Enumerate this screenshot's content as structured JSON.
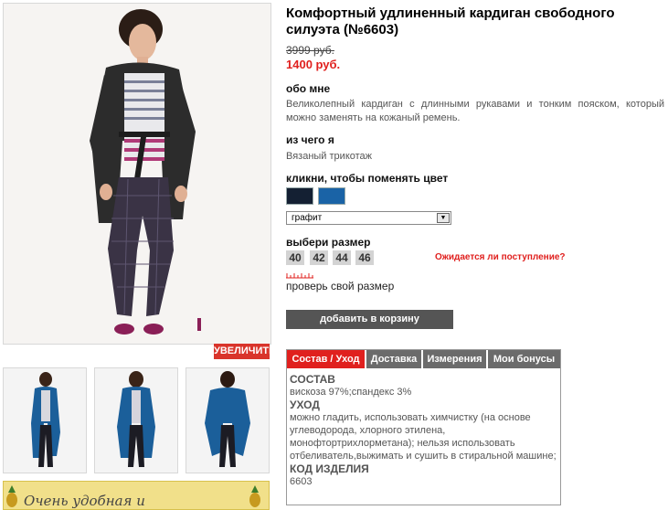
{
  "product": {
    "title": "Комфортный удлиненный кардиган свободного силуэта (№6603)",
    "old_price": "3999 руб.",
    "new_price": "1400 руб.",
    "zoom_label": "УВЕЛИЧИТЬ"
  },
  "about": {
    "heading": "обо мне",
    "text": "Великолепный кардиган с длинными рукавами и тонким пояском, который можно заменять на кожаный ремень."
  },
  "material": {
    "heading": "из чего я",
    "text": "Вязаный трикотаж"
  },
  "color": {
    "heading": "кликни, чтобы поменять цвет",
    "swatches": [
      "#142033",
      "#1a63a6"
    ],
    "selected": "графит"
  },
  "size": {
    "heading": "выбери размер",
    "options": [
      "40",
      "42",
      "44",
      "46"
    ],
    "availability_link": "Ожидается ли поступление?",
    "check_link": "проверь свой размер"
  },
  "cart_button": "добавить в корзину",
  "tabs": {
    "items": [
      "Состав / Уход",
      "Доставка",
      "Измерения",
      "Мои бонусы"
    ],
    "composition_heading": "СОСТАВ",
    "composition_text": "вискоза 97%;спандекс 3%",
    "care_heading": "УХОД",
    "care_text": "можно гладить, использовать химчистку (на основе углеводорода, хлорного этилена, монофтортрихлорметана); нельзя использовать отбеливатель,выжимать и сушить в стиральной машине;",
    "code_heading": "КОД ИЗДЕЛИЯ",
    "code_value": "6603"
  },
  "banner": {
    "text": "Очень удобная и"
  }
}
